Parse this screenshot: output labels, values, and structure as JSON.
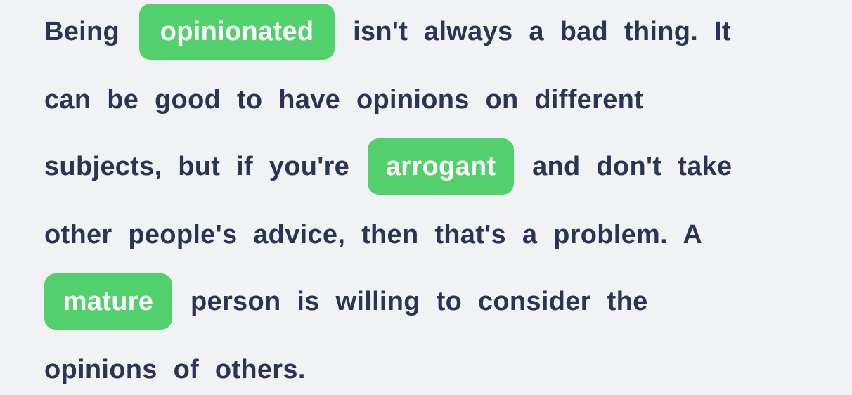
{
  "passage": {
    "line1": {
      "before": "Being",
      "highlight": "opinionated",
      "after": "isn't always a bad thing. It"
    },
    "line2": {
      "text": "can be good to have opinions on different"
    },
    "line3": {
      "before": "subjects, but if you're",
      "highlight": "arrogant",
      "after": "and don't take"
    },
    "line4": {
      "text": "other people's advice, then that's a problem. A"
    },
    "line5": {
      "highlight": "mature",
      "after": "person is willing to consider the"
    },
    "line6": {
      "text": "opinions of others."
    }
  },
  "colors": {
    "background": "#f1f2f4",
    "text": "#2b3450",
    "highlight_background": "#52d06b",
    "highlight_text": "#ffffff"
  }
}
